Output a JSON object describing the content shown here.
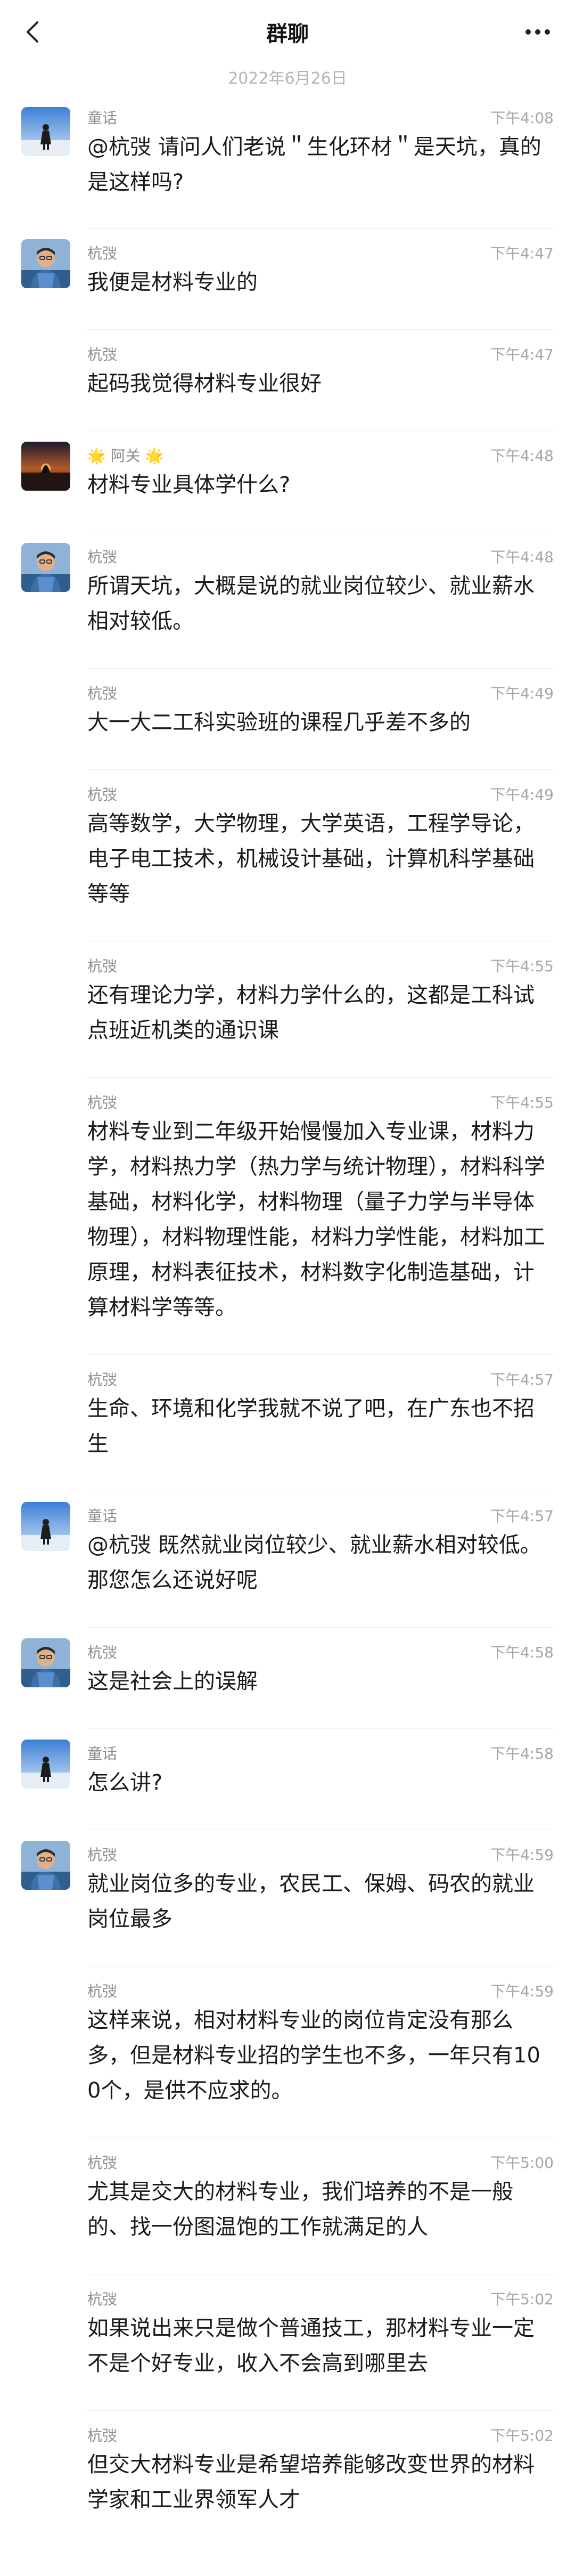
{
  "header": {
    "title": "群聊"
  },
  "date_separator": "2022年6月26日",
  "messages": [
    {
      "name": "童话",
      "time": "下午4:08",
      "text": "@杭弢 请问人们老说＂生化环材＂是天坑，真的是这样吗?",
      "avatar": "tonghua"
    },
    {
      "name": "杭弢",
      "time": "下午4:47",
      "text": "我便是材料专业的",
      "avatar": "hangtao"
    },
    {
      "name": "杭弢",
      "time": "下午4:47",
      "text": "起码我觉得材料专业很好",
      "avatar": ""
    },
    {
      "name": "🌟 阿关 🌟",
      "time": "下午4:48",
      "text": "材料专业具体学什么?",
      "avatar": "aguan"
    },
    {
      "name": "杭弢",
      "time": "下午4:48",
      "text": "所谓天坑，大概是说的就业岗位较少、就业薪水相对较低。",
      "avatar": "hangtao"
    },
    {
      "name": "杭弢",
      "time": "下午4:49",
      "text": "大一大二工科实验班的课程几乎差不多的",
      "avatar": ""
    },
    {
      "name": "杭弢",
      "time": "下午4:49",
      "text": "高等数学，大学物理，大学英语，工程学导论，电子电工技术，机械设计基础，计算机科学基础等等",
      "avatar": ""
    },
    {
      "name": "杭弢",
      "time": "下午4:55",
      "text": "还有理论力学，材料力学什么的，这都是工科试点班近机类的通识课",
      "avatar": ""
    },
    {
      "name": "杭弢",
      "time": "下午4:55",
      "text": "材料专业到二年级开始慢慢加入专业课，材料力学，材料热力学（热力学与统计物理），材料科学基础，材料化学，材料物理（量子力学与半导体物理），材料物理性能，材料力学性能，材料加工原理，材料表征技术，材料数字化制造基础，计算材料学等等。",
      "avatar": ""
    },
    {
      "name": "杭弢",
      "time": "下午4:57",
      "text": "生命、环境和化学我就不说了吧，在广东也不招生",
      "avatar": ""
    },
    {
      "name": "童话",
      "time": "下午4:57",
      "text": "@杭弢 既然就业岗位较少、就业薪水相对较低。那您怎么还说好呢",
      "avatar": "tonghua"
    },
    {
      "name": "杭弢",
      "time": "下午4:58",
      "text": "这是社会上的误解",
      "avatar": "hangtao"
    },
    {
      "name": "童话",
      "time": "下午4:58",
      "text": "怎么讲?",
      "avatar": "tonghua"
    },
    {
      "name": "杭弢",
      "time": "下午4:59",
      "text": "就业岗位多的专业，农民工、保姆、码农的就业岗位最多",
      "avatar": "hangtao"
    },
    {
      "name": "杭弢",
      "time": "下午4:59",
      "text": "这样来说，相对材料专业的岗位肯定没有那么多，但是材料专业招的学生也不多，一年只有100个，是供不应求的。",
      "avatar": ""
    },
    {
      "name": "杭弢",
      "time": "下午5:00",
      "text": "尤其是交大的材料专业，我们培养的不是一般的、找一份图温饱的工作就满足的人",
      "avatar": ""
    },
    {
      "name": "杭弢",
      "time": "下午5:02",
      "text": "如果说出来只是做个普通技工，那材料专业一定不是个好专业，收入不会高到哪里去",
      "avatar": ""
    },
    {
      "name": "杭弢",
      "time": "下午5:02",
      "text": "但交大材料专业是希望培养能够改变世界的材料学家和工业界领军人才",
      "avatar": ""
    }
  ]
}
